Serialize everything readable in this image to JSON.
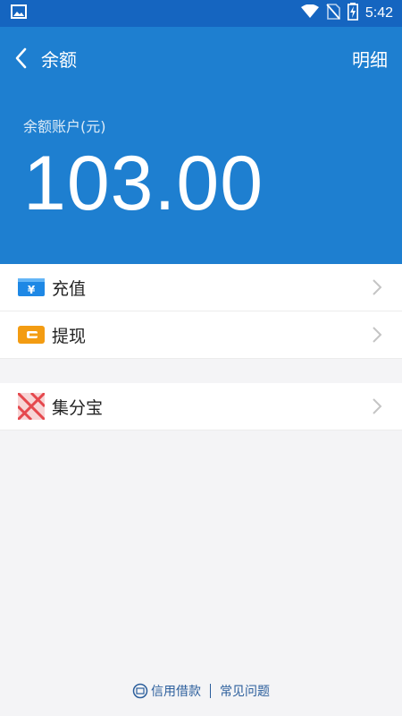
{
  "status_bar": {
    "time": "5:42",
    "icons": [
      "image-icon",
      "wifi-icon",
      "no-sim-icon",
      "battery-charging-icon"
    ]
  },
  "nav": {
    "back_icon": "chevron-left-icon",
    "title": "余额",
    "detail_label": "明细"
  },
  "balance": {
    "label": "余额账户(元)",
    "amount": "103.00"
  },
  "menu": {
    "group1": [
      {
        "label": "充值",
        "icon": "recharge-yen-icon",
        "color": "#1e88e5"
      },
      {
        "label": "提现",
        "icon": "wallet-icon",
        "color": "#f39c12"
      }
    ],
    "group2": [
      {
        "label": "集分宝",
        "icon": "jifenbao-icon",
        "color": "#e5484d"
      }
    ]
  },
  "footer": {
    "credit_loan": "信用借款",
    "faq": "常见问题"
  },
  "colors": {
    "header_bg": "#1e7fd0",
    "status_bg": "#1565c0",
    "page_bg": "#f4f4f6",
    "link": "#2b5e9c"
  }
}
